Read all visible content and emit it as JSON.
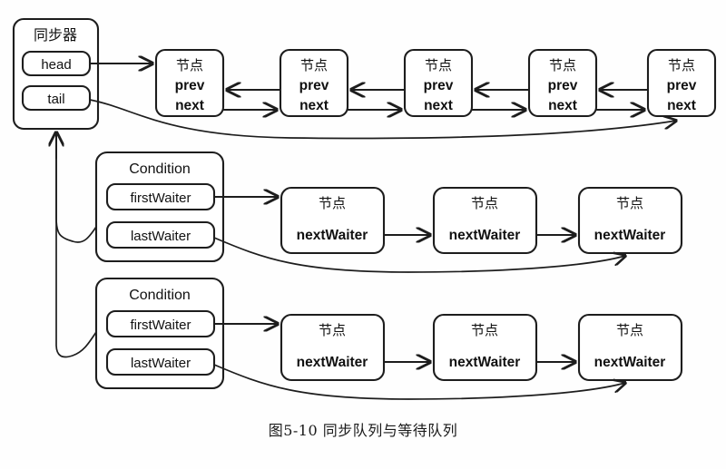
{
  "figure": {
    "caption": "图5-10  同步队列与等待队列",
    "background": "#fefefe",
    "line_color": "#1d1d1d"
  },
  "synchronizer": {
    "title": "同步器",
    "fields": [
      {
        "label": "head"
      },
      {
        "label": "tail"
      }
    ]
  },
  "sync_queue": {
    "node_title": "节点",
    "field_prev": "prev",
    "field_next": "next",
    "node_count": 5,
    "nodes": [
      {
        "title": "节点",
        "prev": "prev",
        "next": "next"
      },
      {
        "title": "节点",
        "prev": "prev",
        "next": "next"
      },
      {
        "title": "节点",
        "prev": "prev",
        "next": "next"
      },
      {
        "title": "节点",
        "prev": "prev",
        "next": "next"
      },
      {
        "title": "节点",
        "prev": "prev",
        "next": "next"
      }
    ]
  },
  "conditions": [
    {
      "title": "Condition",
      "first_waiter": "firstWaiter",
      "last_waiter": "lastWaiter",
      "waiters": [
        {
          "title": "节点",
          "next_waiter": "nextWaiter"
        },
        {
          "title": "节点",
          "next_waiter": "nextWaiter"
        },
        {
          "title": "节点",
          "next_waiter": "nextWaiter"
        }
      ]
    },
    {
      "title": "Condition",
      "first_waiter": "firstWaiter",
      "last_waiter": "lastWaiter",
      "waiters": [
        {
          "title": "节点",
          "next_waiter": "nextWaiter"
        },
        {
          "title": "节点",
          "next_waiter": "nextWaiter"
        },
        {
          "title": "节点",
          "next_waiter": "nextWaiter"
        }
      ]
    }
  ]
}
